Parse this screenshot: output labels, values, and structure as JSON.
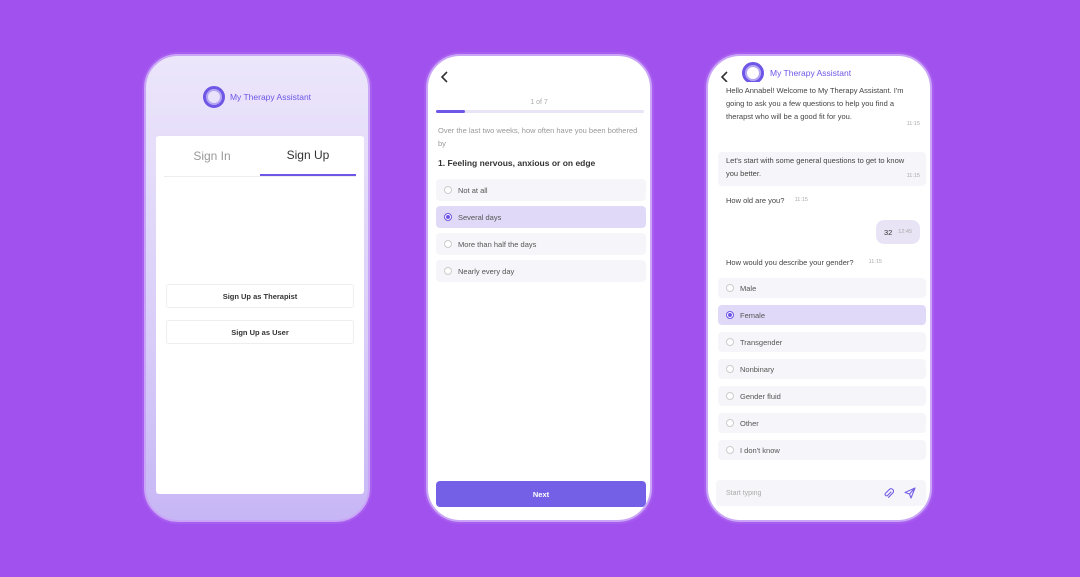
{
  "signup_screen": {
    "app_name": "My Therapy Assistant",
    "tabs": [
      "Sign In",
      "Sign Up"
    ],
    "buttons": {
      "therapist": "Sign Up as Therapist",
      "user": "Sign Up as User"
    }
  },
  "question_screen": {
    "page_count": "1 of 7",
    "progress": 0.14,
    "intro": "Over the last two weeks, how often have you been bothered by",
    "question": "1. Feeling nervous, anxious or on edge",
    "options": [
      {
        "label": "Not at all",
        "selected": false
      },
      {
        "label": "Several days",
        "selected": true
      },
      {
        "label": "More than half the days",
        "selected": false
      },
      {
        "label": "Nearly every day",
        "selected": false
      }
    ],
    "next_label": "Next"
  },
  "chat_screen": {
    "app_name": "My Therapy Assistant",
    "messages": [
      {
        "text": "Hello Annabel! Welcome to My Therapy Assistant. I'm going to ask you a few questions to help you find a therapst who will be a good fit for you.",
        "time": "11:15"
      },
      {
        "text": "Let's start with some general questions to get to know you better.",
        "time": "11:15"
      },
      {
        "text": "How old are you?",
        "time": "11:15"
      },
      {
        "text": "How would you describe your gender?",
        "time": "11:15"
      }
    ],
    "reply": {
      "text": "32",
      "time": "12:45"
    },
    "options": [
      {
        "label": "Male",
        "selected": false
      },
      {
        "label": "Female",
        "selected": true
      },
      {
        "label": "Transgender",
        "selected": false
      },
      {
        "label": "Nonbinary",
        "selected": false
      },
      {
        "label": "Gender fluid",
        "selected": false
      },
      {
        "label": "Other",
        "selected": false
      },
      {
        "label": "I don't know",
        "selected": false
      }
    ],
    "input_placeholder": "Start typing"
  },
  "colors": {
    "background": "#a152ee",
    "accent": "#6e56e6",
    "selected_bg": "#e0daf8"
  }
}
